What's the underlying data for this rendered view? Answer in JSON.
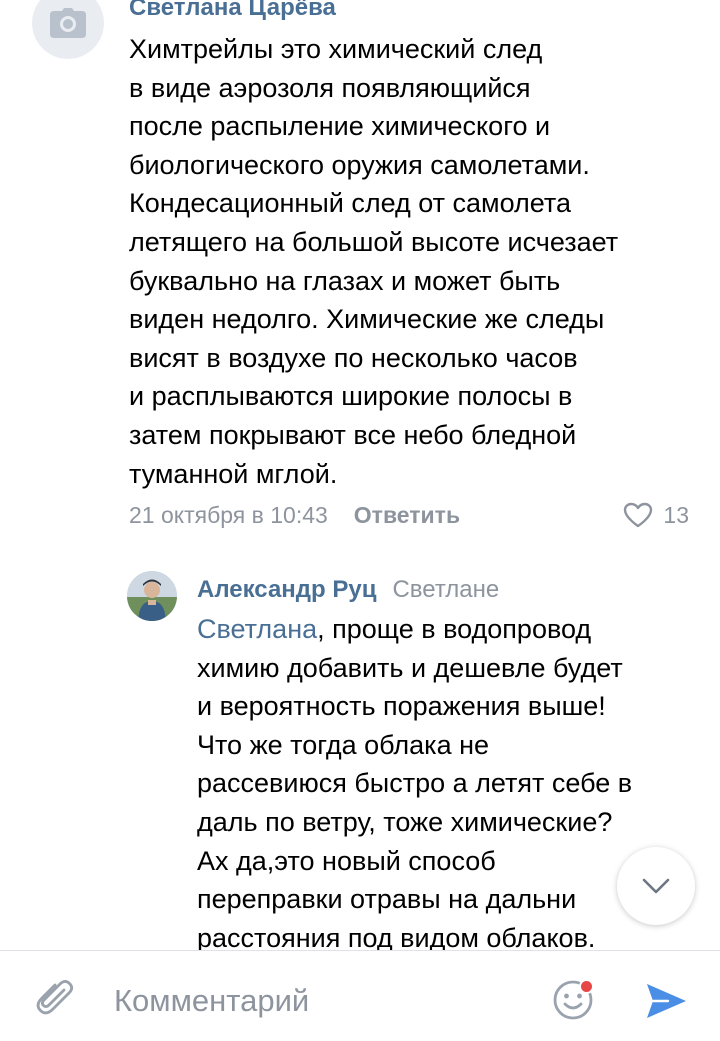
{
  "comment": {
    "author": "Светлана Царёва",
    "avatar_icon": "camera-icon",
    "text_lines": [
      "Химтрейлы это химический след",
      "в виде аэрозоля появляющийся",
      "после распыление химического и",
      "биологического оружия самолетами.",
      "Кондесационный след от самолета",
      "летящего на большой высоте исчезает",
      "буквально на глазах и может быть",
      "виден недолго. Химические же следы",
      "висят в воздухе по несколько часов",
      "и расплываются широкие полосы в",
      "затем покрывают все небо бледной",
      "туманной мглой."
    ],
    "date": "21 октября в 10:43",
    "reply_label": "Ответить",
    "like_icon": "heart-icon",
    "likes": "13"
  },
  "reply": {
    "author": "Александр Руц",
    "reply_to": "Светлане",
    "mention": "Светлана",
    "first_line_rest": ", проще в водопровод",
    "text_lines": [
      "химию добавить и дешевле будет",
      "и вероятность поражения выше!",
      "Что же тогда облака не",
      "рассевиюся быстро а летят себе в",
      "даль по ветру, тоже химические?",
      "Ах да,это новый способ",
      "переправки отравы на дальни",
      "расстояния под видом облаков."
    ]
  },
  "scroll_button_icon": "chevron-down-icon",
  "input_bar": {
    "placeholder": "Комментарий",
    "attach_icon": "paperclip-icon",
    "emoji_icon": "smile-icon",
    "send_icon": "send-icon"
  },
  "colors": {
    "link": "#4a6f95",
    "meta": "#8d949e",
    "send": "#4a8ee6",
    "notification_dot": "#e64646"
  }
}
